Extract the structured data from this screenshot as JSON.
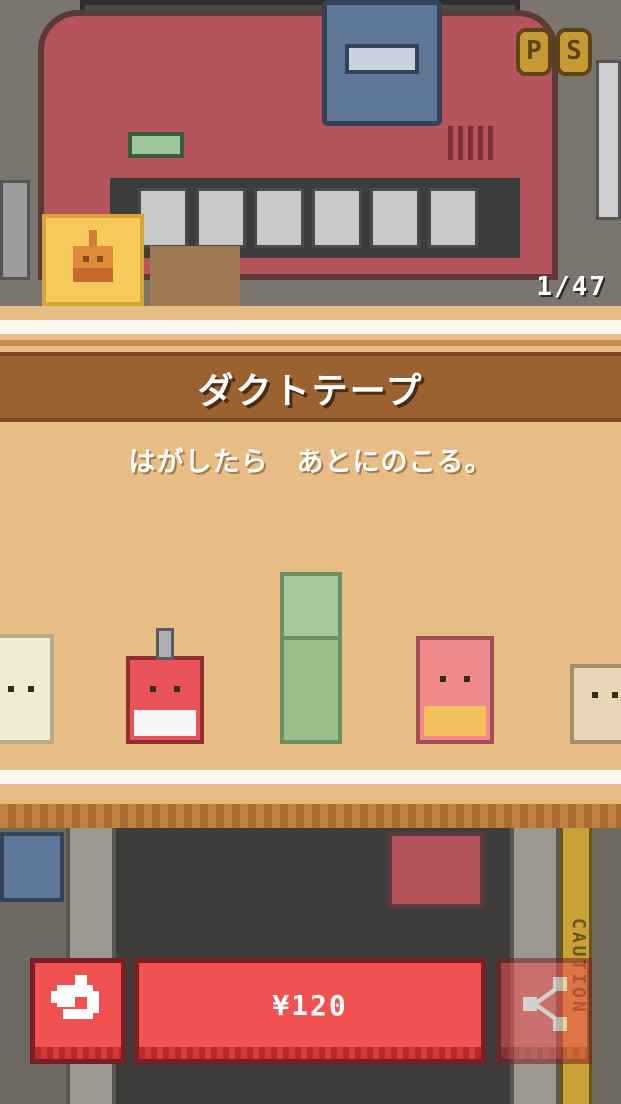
{
  "header": {
    "coin_letters": [
      "P",
      "S"
    ],
    "item_counter": "1/47",
    "selected_item_icon": "tape-dispenser-icon"
  },
  "item": {
    "name": "ダクトテープ",
    "description": "はがしたら　あとにのこる。"
  },
  "carousel": {
    "items": [
      {
        "name": "masking-tape",
        "color": "#f3ead3"
      },
      {
        "name": "red-tape-dispenser",
        "color": "#e9535a"
      },
      {
        "name": "green-tape-roll",
        "color": "#9bbf8a"
      },
      {
        "name": "pink-tape",
        "color": "#f08a8c"
      },
      {
        "name": "beige-tape",
        "color": "#e8d6b6"
      }
    ],
    "selected_index": 2
  },
  "scene": {
    "caution_text": "CAUTION"
  },
  "actions": {
    "back_icon": "undo-arrow-icon",
    "buy_label": "¥120",
    "share_icon": "share-icon"
  },
  "colors": {
    "panel_bg": "#e8bc85",
    "title_band": "#9a6131",
    "button_red": "#f15150",
    "button_border": "#7a1f24"
  }
}
